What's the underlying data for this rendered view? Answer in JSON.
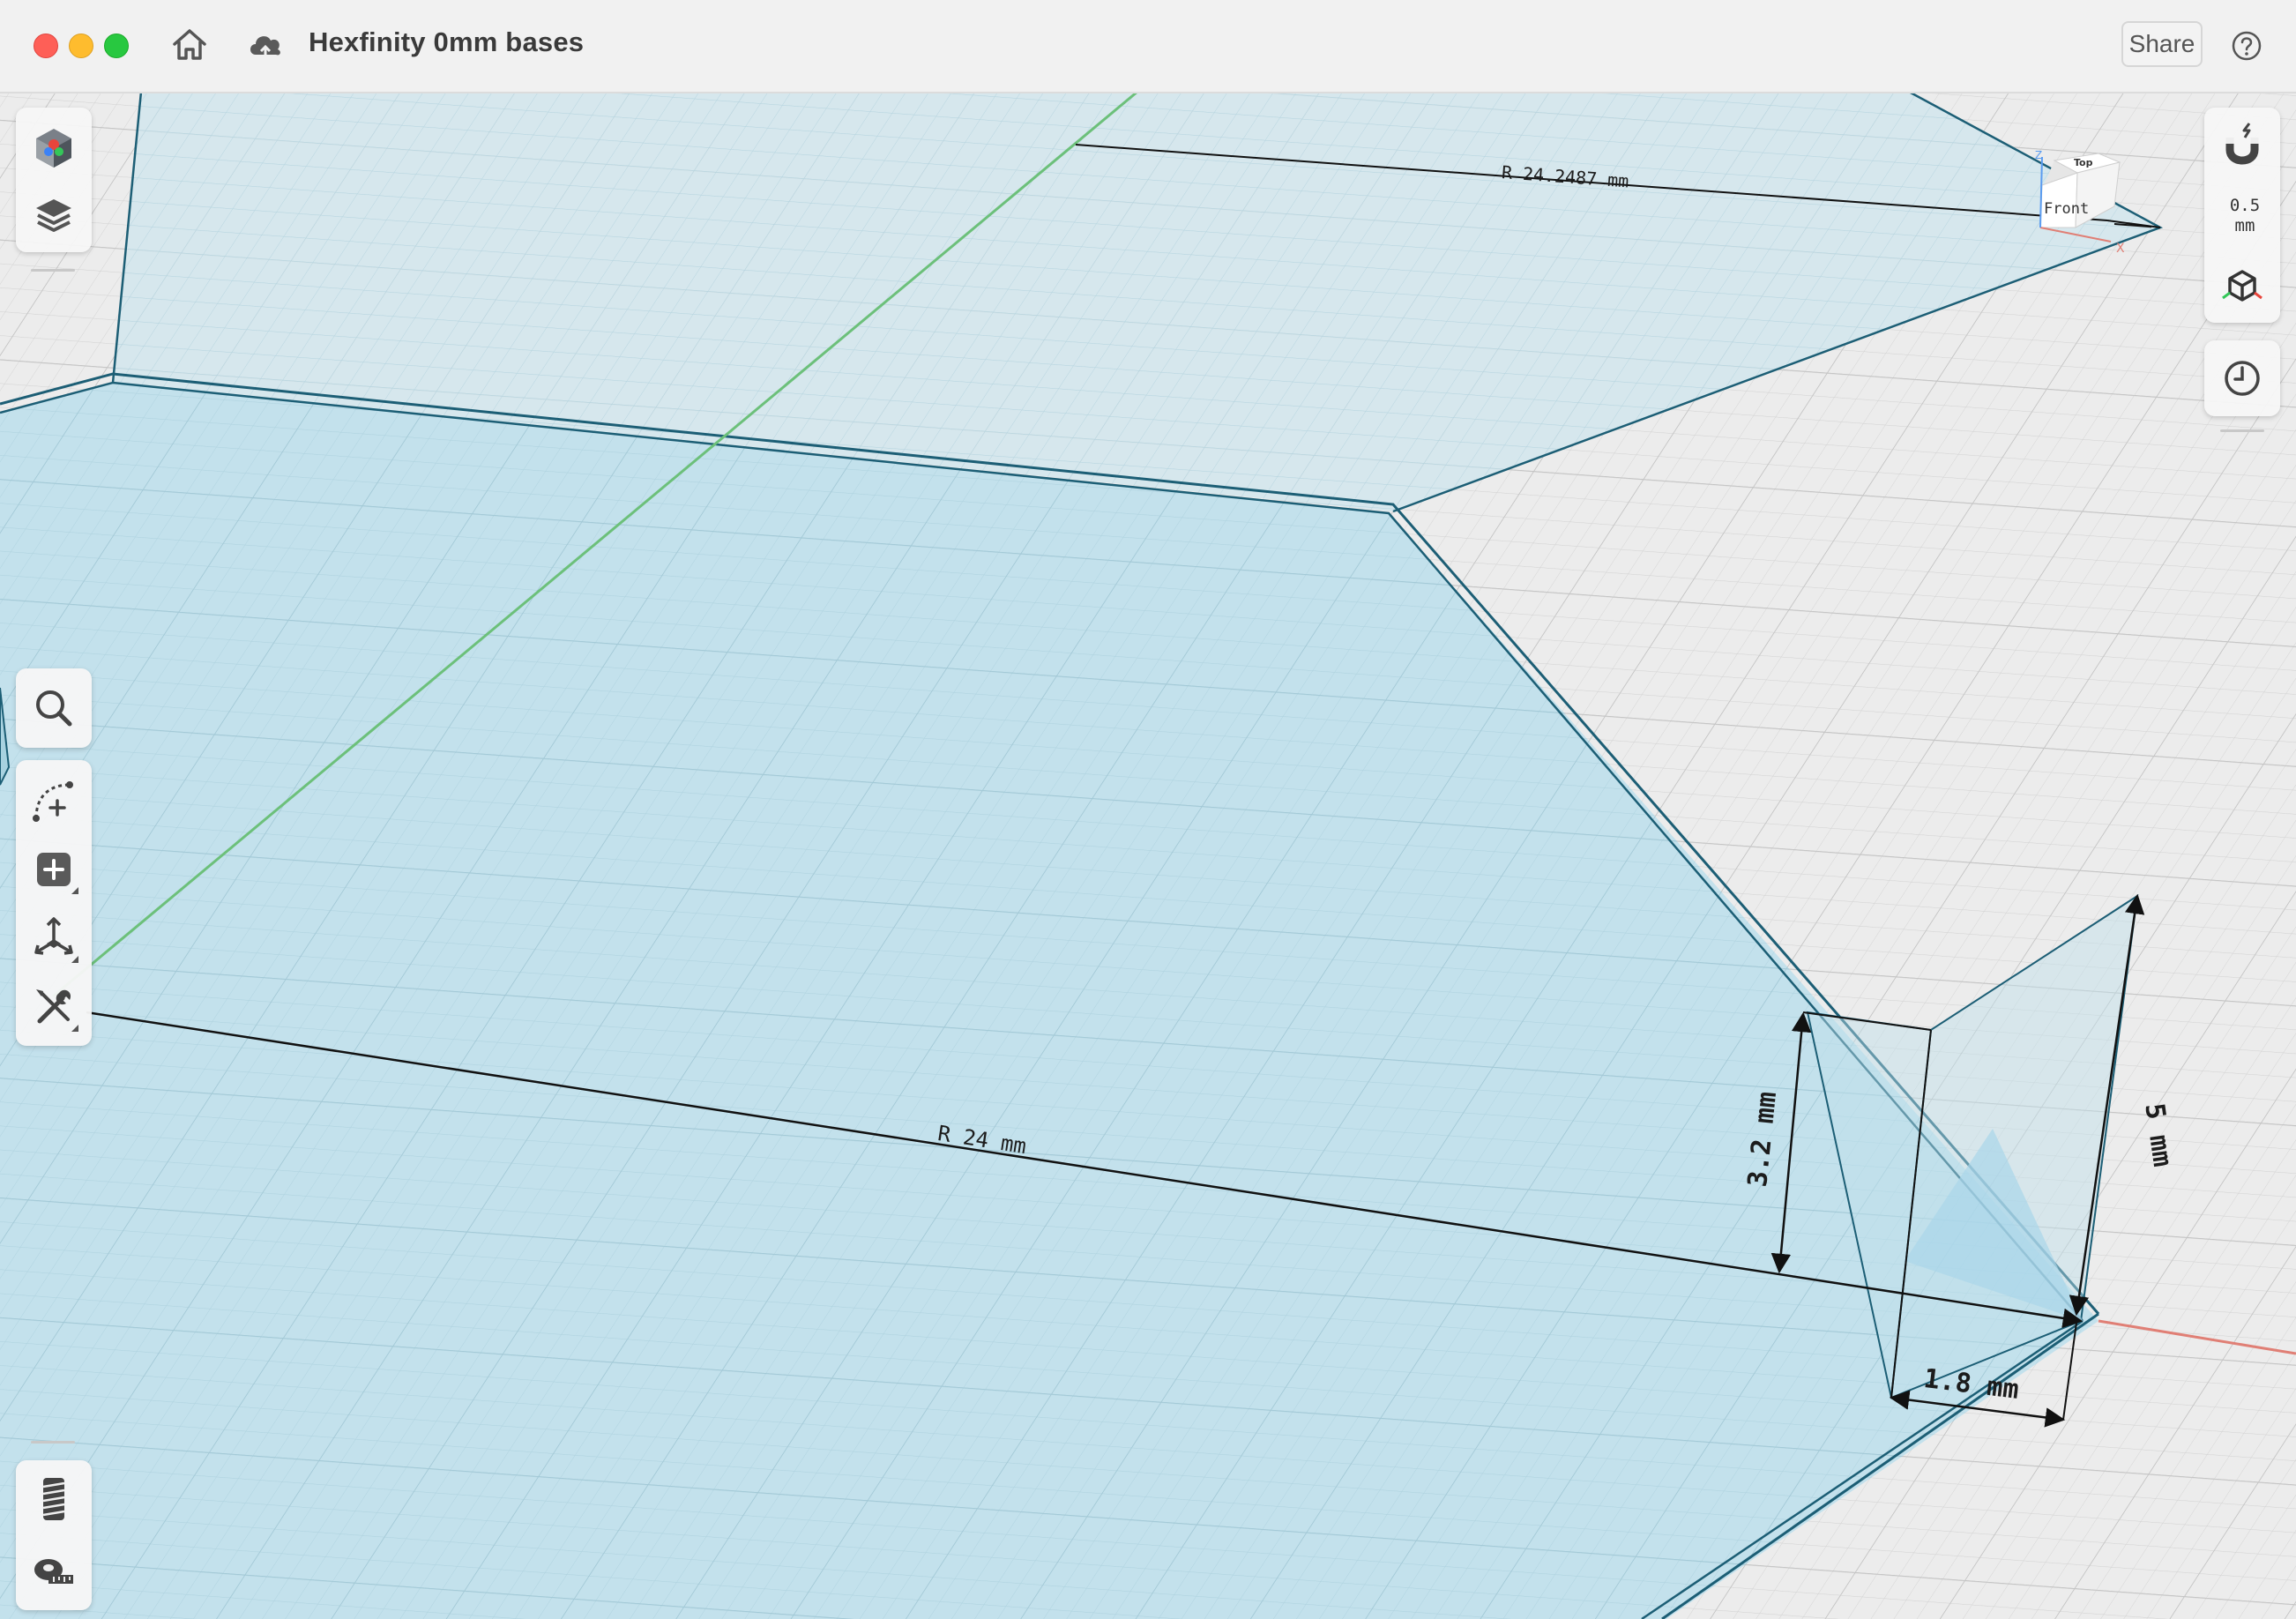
{
  "window": {
    "title": "Hexfinity 0mm bases",
    "share_label": "Share"
  },
  "icons": {
    "home": "house-icon",
    "cloud": "cloud-upload-icon",
    "help": "question-mark-icon",
    "appearance": "colored-cube-icon",
    "layers": "layers-icon",
    "search": "magnifier-icon",
    "sketch": "sketch-arc-icon",
    "add": "plus-square-icon",
    "move": "move-arrows-icon",
    "tools": "wrench-screwdriver-icon",
    "thread": "thread-icon",
    "measure": "tape-measure-icon",
    "snap": "magnet-icon",
    "view": "iso-cube-icon",
    "history": "clock-icon"
  },
  "snap": {
    "value": "0.5",
    "unit": "mm"
  },
  "viewcube": {
    "top_label": "Top",
    "front_label": "Front",
    "x_axis_label": "X",
    "z_axis_label": "Z"
  },
  "dimensions": {
    "radius_top": "R 24.2487 mm",
    "radius_main": "R 24 mm",
    "height_inner": "3.2 mm",
    "height_outer": "5 mm",
    "width_lip": "1.8 mm"
  },
  "colors": {
    "face_fill": "#bfe0ec",
    "edge": "#1c5e75",
    "grid_axis_green": "#6cc07a",
    "grid_axis_red": "#e07f75",
    "title_bar": "#f1f1f1"
  }
}
